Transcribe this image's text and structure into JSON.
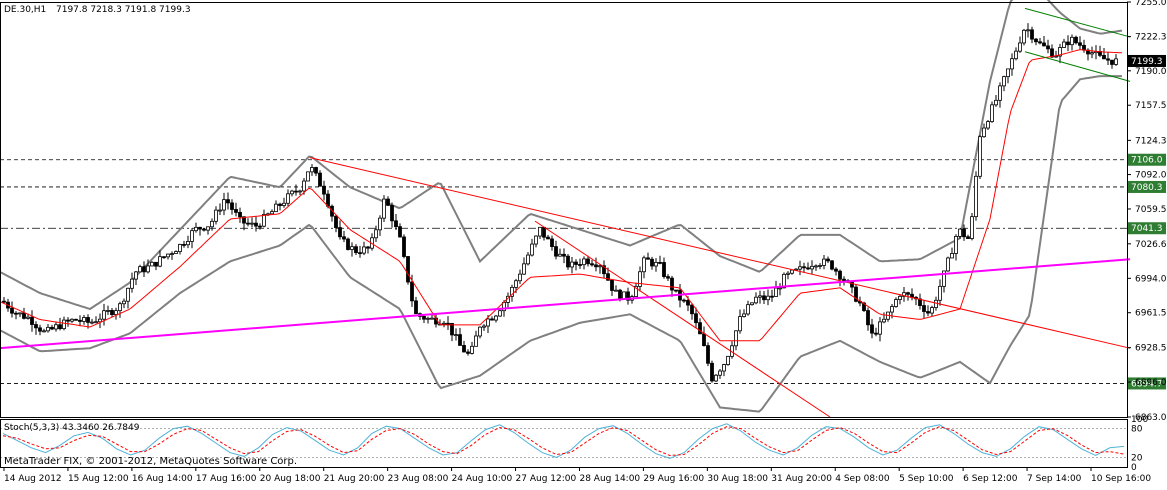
{
  "header": {
    "symbol": "DE.30,H1",
    "ohlc": "7197.8 7218.3 7191.8 7199.3"
  },
  "stoch_header": "Stoch(5,3,3) 43.3460 26.7849",
  "copyright": "MetaTrader FIX, © 2001-2012, MetaQuotes Software Corp.",
  "colors": {
    "background": "#ffffff",
    "candles": "#000000",
    "bollinger": "#808080",
    "moving_average": "#ff0000",
    "trendline_red": "#ff0000",
    "trendline_magenta": "#ff00ff",
    "channel": "#008000",
    "level_line": "#000000",
    "level_green_box": "#2e7d32",
    "current_price_box": "#000000",
    "stoch_main": "#4fb3d9",
    "stoch_signal": "#ff0000"
  },
  "chart_data": [
    {
      "type": "candlestick",
      "title": "DE.30,H1",
      "ylim": [
        6863.0,
        7255.0
      ],
      "price_axis_ticks": [
        "7255.0",
        "7222.3",
        "7190.0",
        "7157.5",
        "7124.3",
        "7092.0",
        "7059.5",
        "7026.6",
        "6994.0",
        "6961.5",
        "6928.5",
        "6896.0",
        "6863.0"
      ],
      "time_axis_ticks": [
        "14 Aug 2012",
        "15 Aug 12:00",
        "16 Aug 14:00",
        "17 Aug 16:00",
        "20 Aug 18:00",
        "21 Aug 20:00",
        "23 Aug 08:00",
        "24 Aug 10:00",
        "27 Aug 12:00",
        "28 Aug 14:00",
        "29 Aug 16:00",
        "30 Aug 18:00",
        "31 Aug 20:00",
        "4 Sep 08:00",
        "5 Sep 10:00",
        "6 Sep 12:00",
        "7 Sep 14:00",
        "10 Sep 16:00"
      ],
      "horizontal_levels": [
        {
          "value": 7106.0,
          "label": "7106.0",
          "style": "dashed"
        },
        {
          "value": 7080.3,
          "label": "7080.3",
          "style": "dashed"
        },
        {
          "value": 7041.3,
          "label": "7041.3",
          "style": "dash-dot"
        },
        {
          "value": 6894.7,
          "label": "6894.7",
          "style": "dashed"
        }
      ],
      "current_price": {
        "value": 7199.3,
        "label": "7199.3"
      },
      "close_path": [
        [
          0,
          6975
        ],
        [
          15,
          6962
        ],
        [
          30,
          6956
        ],
        [
          45,
          6942
        ],
        [
          60,
          6950
        ],
        [
          75,
          6955
        ],
        [
          90,
          6952
        ],
        [
          105,
          6960
        ],
        [
          120,
          6968
        ],
        [
          135,
          7000
        ],
        [
          150,
          7005
        ],
        [
          165,
          7015
        ],
        [
          180,
          7025
        ],
        [
          195,
          7040
        ],
        [
          210,
          7045
        ],
        [
          225,
          7070
        ],
        [
          240,
          7048
        ],
        [
          255,
          7043
        ],
        [
          270,
          7055
        ],
        [
          285,
          7068
        ],
        [
          300,
          7080
        ],
        [
          310,
          7100
        ],
        [
          325,
          7075
        ],
        [
          340,
          7030
        ],
        [
          355,
          7020
        ],
        [
          370,
          7022
        ],
        [
          385,
          7070
        ],
        [
          400,
          7030
        ],
        [
          415,
          6960
        ],
        [
          430,
          6955
        ],
        [
          445,
          6955
        ],
        [
          460,
          6930
        ],
        [
          470,
          6920
        ],
        [
          480,
          6950
        ],
        [
          495,
          6960
        ],
        [
          510,
          6980
        ],
        [
          525,
          7010
        ],
        [
          540,
          7040
        ],
        [
          555,
          7020
        ],
        [
          570,
          7005
        ],
        [
          585,
          7012
        ],
        [
          600,
          7008
        ],
        [
          615,
          6980
        ],
        [
          630,
          6975
        ],
        [
          645,
          7012
        ],
        [
          660,
          7005
        ],
        [
          675,
          6980
        ],
        [
          690,
          6965
        ],
        [
          702,
          6935
        ],
        [
          712,
          6900
        ],
        [
          725,
          6915
        ],
        [
          740,
          6955
        ],
        [
          755,
          6975
        ],
        [
          770,
          6975
        ],
        [
          785,
          6995
        ],
        [
          800,
          7002
        ],
        [
          815,
          7010
        ],
        [
          830,
          7008
        ],
        [
          845,
          6992
        ],
        [
          860,
          6970
        ],
        [
          872,
          6940
        ],
        [
          885,
          6955
        ],
        [
          900,
          6980
        ],
        [
          915,
          6975
        ],
        [
          930,
          6960
        ],
        [
          945,
          7000
        ],
        [
          958,
          7040
        ],
        [
          970,
          7030
        ],
        [
          980,
          7130
        ],
        [
          995,
          7160
        ],
        [
          1010,
          7195
        ],
        [
          1025,
          7232
        ],
        [
          1040,
          7215
        ],
        [
          1055,
          7205
        ],
        [
          1070,
          7220
        ],
        [
          1085,
          7212
        ],
        [
          1100,
          7202
        ],
        [
          1115,
          7199
        ]
      ],
      "series": [
        {
          "name": "",
          "kind": "bollinger_upper",
          "x": [
            0,
            40,
            90,
            130,
            180,
            230,
            280,
            310,
            350,
            400,
            440,
            480,
            530,
            580,
            630,
            680,
            720,
            760,
            800,
            840,
            880,
            920,
            960,
            990,
            1010,
            1030,
            1060,
            1080,
            1100,
            1122
          ],
          "values": [
            7000,
            6980,
            6965,
            6990,
            7040,
            7090,
            7080,
            7110,
            7080,
            7060,
            7085,
            7010,
            7055,
            7040,
            7025,
            7045,
            7015,
            7000,
            7035,
            7035,
            7010,
            7012,
            7032,
            7180,
            7255,
            7275,
            7245,
            7230,
            7225,
            7228
          ]
        },
        {
          "name": "",
          "kind": "bollinger_lower",
          "x": [
            0,
            40,
            90,
            130,
            180,
            230,
            280,
            310,
            350,
            400,
            440,
            480,
            530,
            580,
            630,
            680,
            720,
            760,
            800,
            840,
            880,
            920,
            960,
            990,
            1010,
            1030,
            1060,
            1080,
            1100,
            1122
          ],
          "values": [
            6945,
            6925,
            6928,
            6942,
            6980,
            7010,
            7025,
            7045,
            6995,
            6965,
            6890,
            6902,
            6935,
            6952,
            6960,
            6935,
            6872,
            6868,
            6920,
            6935,
            6915,
            6900,
            6915,
            6895,
            6930,
            6960,
            7160,
            7182,
            7185,
            7185
          ]
        },
        {
          "name": "",
          "kind": "moving_average",
          "x": [
            0,
            40,
            90,
            130,
            180,
            230,
            280,
            310,
            350,
            400,
            440,
            480,
            530,
            580,
            630,
            680,
            720,
            760,
            800,
            840,
            880,
            920,
            960,
            990,
            1010,
            1030,
            1060,
            1080,
            1100,
            1122
          ],
          "values": [
            6972,
            6955,
            6948,
            6965,
            7005,
            7050,
            7055,
            7080,
            7040,
            7010,
            6950,
            6950,
            6995,
            6998,
            6990,
            6985,
            6935,
            6935,
            6980,
            6985,
            6960,
            6955,
            6965,
            7050,
            7150,
            7200,
            7205,
            7210,
            7208,
            7207
          ]
        }
      ],
      "trendlines": [
        {
          "kind": "red_down_1",
          "color": "#ff0000",
          "points": [
            [
              310,
              7108
            ],
            [
              1130,
              6928
            ]
          ]
        },
        {
          "kind": "red_down_2",
          "color": "#ff0000",
          "points": [
            [
              535,
              7048
            ],
            [
              830,
              6863
            ]
          ]
        },
        {
          "kind": "magenta_up",
          "color": "#ff00ff",
          "points": [
            [
              0,
              6928
            ],
            [
              1130,
              7012
            ]
          ]
        },
        {
          "kind": "channel_upper",
          "color": "#008000",
          "points": [
            [
              1025,
              7249
            ],
            [
              1130,
              7222
            ]
          ]
        },
        {
          "kind": "channel_lower",
          "color": "#008000",
          "points": [
            [
              1025,
              7208
            ],
            [
              1130,
              7180
            ]
          ]
        }
      ]
    },
    {
      "type": "line",
      "title": "Stoch(5,3,3) 43.3460 26.7849",
      "ylim": [
        0,
        100
      ],
      "levels": [
        20,
        80
      ],
      "axis_ticks": [
        "100",
        "80",
        "20",
        "0"
      ],
      "series": [
        {
          "name": "",
          "kind": "main",
          "values": [
            70,
            55,
            40,
            30,
            45,
            65,
            72,
            60,
            38,
            25,
            35,
            60,
            80,
            85,
            70,
            50,
            30,
            22,
            40,
            68,
            82,
            75,
            55,
            35,
            25,
            40,
            70,
            85,
            80,
            60,
            40,
            25,
            30,
            55,
            78,
            88,
            72,
            50,
            30,
            20,
            35,
            62,
            80,
            86,
            70,
            48,
            28,
            18,
            30,
            58,
            80,
            90,
            75,
            52,
            35,
            25,
            40,
            66,
            84,
            80,
            62,
            40,
            25,
            35,
            60,
            82,
            88,
            70,
            48,
            30,
            22,
            38,
            64,
            84,
            78,
            58,
            38,
            24,
            40,
            43
          ]
        },
        {
          "name": "",
          "kind": "signal",
          "values": [
            65,
            60,
            48,
            38,
            40,
            55,
            66,
            64,
            48,
            32,
            32,
            48,
            68,
            80,
            76,
            58,
            40,
            28,
            32,
            55,
            74,
            78,
            64,
            45,
            30,
            34,
            58,
            76,
            80,
            68,
            48,
            32,
            28,
            45,
            68,
            82,
            78,
            60,
            40,
            26,
            30,
            50,
            70,
            82,
            76,
            56,
            36,
            24,
            26,
            46,
            70,
            84,
            80,
            60,
            42,
            30,
            34,
            56,
            76,
            82,
            70,
            50,
            32,
            30,
            50,
            72,
            84,
            76,
            56,
            36,
            26,
            32,
            54,
            76,
            80,
            66,
            46,
            30,
            32,
            26.78
          ]
        }
      ]
    }
  ]
}
